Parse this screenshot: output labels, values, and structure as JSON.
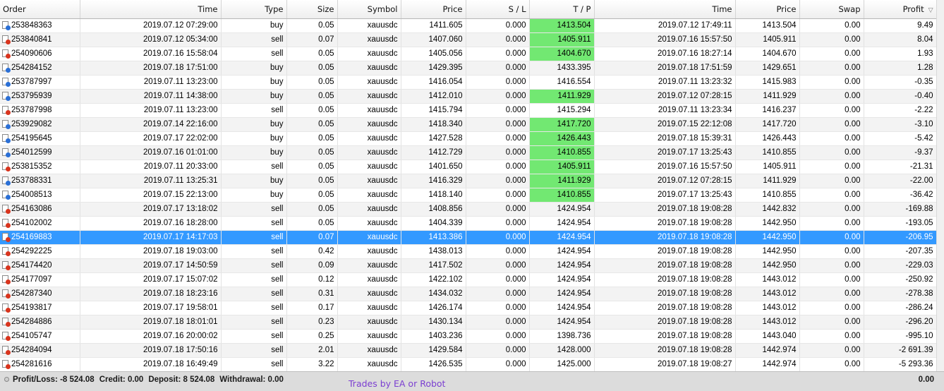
{
  "columns": [
    {
      "key": "order",
      "label": "Order"
    },
    {
      "key": "time",
      "label": "Time"
    },
    {
      "key": "type",
      "label": "Type"
    },
    {
      "key": "size",
      "label": "Size"
    },
    {
      "key": "symbol",
      "label": "Symbol"
    },
    {
      "key": "price",
      "label": "Price"
    },
    {
      "key": "sl",
      "label": "S / L"
    },
    {
      "key": "tp",
      "label": "T / P"
    },
    {
      "key": "close_time",
      "label": "Time"
    },
    {
      "key": "close_price",
      "label": "Price"
    },
    {
      "key": "swap",
      "label": "Swap"
    },
    {
      "key": "profit",
      "label": "Profit"
    }
  ],
  "sort_column": "profit",
  "sort_icon": "sort-desc-triangle-icon",
  "colors": {
    "tp_hit": "#72e872",
    "selected_row": "#3399ff",
    "buy_icon": "#2a6fd6",
    "sell_icon": "#d9341d",
    "watermark": "#7b3fd1"
  },
  "rows": [
    {
      "order": "253848363",
      "time": "2019.07.12 07:29:00",
      "type": "buy",
      "size": "0.05",
      "symbol": "xauusdc",
      "price": "1411.605",
      "sl": "0.000",
      "tp": "1413.504",
      "tp_hit": true,
      "close_time": "2019.07.12 17:49:11",
      "close_price": "1413.504",
      "swap": "0.00",
      "profit": "9.49"
    },
    {
      "order": "253840841",
      "time": "2019.07.12 05:34:00",
      "type": "sell",
      "size": "0.07",
      "symbol": "xauusdc",
      "price": "1407.060",
      "sl": "0.000",
      "tp": "1405.911",
      "tp_hit": true,
      "close_time": "2019.07.16 15:57:50",
      "close_price": "1405.911",
      "swap": "0.00",
      "profit": "8.04"
    },
    {
      "order": "254090606",
      "time": "2019.07.16 15:58:04",
      "type": "sell",
      "size": "0.05",
      "symbol": "xauusdc",
      "price": "1405.056",
      "sl": "0.000",
      "tp": "1404.670",
      "tp_hit": true,
      "close_time": "2019.07.16 18:27:14",
      "close_price": "1404.670",
      "swap": "0.00",
      "profit": "1.93"
    },
    {
      "order": "254284152",
      "time": "2019.07.18 17:51:00",
      "type": "buy",
      "size": "0.05",
      "symbol": "xauusdc",
      "price": "1429.395",
      "sl": "0.000",
      "tp": "1433.395",
      "tp_hit": false,
      "close_time": "2019.07.18 17:51:59",
      "close_price": "1429.651",
      "swap": "0.00",
      "profit": "1.28"
    },
    {
      "order": "253787997",
      "time": "2019.07.11 13:23:00",
      "type": "buy",
      "size": "0.05",
      "symbol": "xauusdc",
      "price": "1416.054",
      "sl": "0.000",
      "tp": "1416.554",
      "tp_hit": false,
      "close_time": "2019.07.11 13:23:32",
      "close_price": "1415.983",
      "swap": "0.00",
      "profit": "-0.35"
    },
    {
      "order": "253795939",
      "time": "2019.07.11 14:38:00",
      "type": "buy",
      "size": "0.05",
      "symbol": "xauusdc",
      "price": "1412.010",
      "sl": "0.000",
      "tp": "1411.929",
      "tp_hit": true,
      "close_time": "2019.07.12 07:28:15",
      "close_price": "1411.929",
      "swap": "0.00",
      "profit": "-0.40"
    },
    {
      "order": "253787998",
      "time": "2019.07.11 13:23:00",
      "type": "sell",
      "size": "0.05",
      "symbol": "xauusdc",
      "price": "1415.794",
      "sl": "0.000",
      "tp": "1415.294",
      "tp_hit": false,
      "close_time": "2019.07.11 13:23:34",
      "close_price": "1416.237",
      "swap": "0.00",
      "profit": "-2.22"
    },
    {
      "order": "253929082",
      "time": "2019.07.14 22:16:00",
      "type": "buy",
      "size": "0.05",
      "symbol": "xauusdc",
      "price": "1418.340",
      "sl": "0.000",
      "tp": "1417.720",
      "tp_hit": true,
      "close_time": "2019.07.15 22:12:08",
      "close_price": "1417.720",
      "swap": "0.00",
      "profit": "-3.10"
    },
    {
      "order": "254195645",
      "time": "2019.07.17 22:02:00",
      "type": "buy",
      "size": "0.05",
      "symbol": "xauusdc",
      "price": "1427.528",
      "sl": "0.000",
      "tp": "1426.443",
      "tp_hit": true,
      "close_time": "2019.07.18 15:39:31",
      "close_price": "1426.443",
      "swap": "0.00",
      "profit": "-5.42"
    },
    {
      "order": "254012599",
      "time": "2019.07.16 01:01:00",
      "type": "buy",
      "size": "0.05",
      "symbol": "xauusdc",
      "price": "1412.729",
      "sl": "0.000",
      "tp": "1410.855",
      "tp_hit": true,
      "close_time": "2019.07.17 13:25:43",
      "close_price": "1410.855",
      "swap": "0.00",
      "profit": "-9.37"
    },
    {
      "order": "253815352",
      "time": "2019.07.11 20:33:00",
      "type": "sell",
      "size": "0.05",
      "symbol": "xauusdc",
      "price": "1401.650",
      "sl": "0.000",
      "tp": "1405.911",
      "tp_hit": true,
      "close_time": "2019.07.16 15:57:50",
      "close_price": "1405.911",
      "swap": "0.00",
      "profit": "-21.31"
    },
    {
      "order": "253788331",
      "time": "2019.07.11 13:25:31",
      "type": "buy",
      "size": "0.05",
      "symbol": "xauusdc",
      "price": "1416.329",
      "sl": "0.000",
      "tp": "1411.929",
      "tp_hit": true,
      "close_time": "2019.07.12 07:28:15",
      "close_price": "1411.929",
      "swap": "0.00",
      "profit": "-22.00"
    },
    {
      "order": "254008513",
      "time": "2019.07.15 22:13:00",
      "type": "buy",
      "size": "0.05",
      "symbol": "xauusdc",
      "price": "1418.140",
      "sl": "0.000",
      "tp": "1410.855",
      "tp_hit": true,
      "close_time": "2019.07.17 13:25:43",
      "close_price": "1410.855",
      "swap": "0.00",
      "profit": "-36.42"
    },
    {
      "order": "254163086",
      "time": "2019.07.17 13:18:02",
      "type": "sell",
      "size": "0.05",
      "symbol": "xauusdc",
      "price": "1408.856",
      "sl": "0.000",
      "tp": "1424.954",
      "tp_hit": false,
      "close_time": "2019.07.18 19:08:28",
      "close_price": "1442.832",
      "swap": "0.00",
      "profit": "-169.88"
    },
    {
      "order": "254102002",
      "time": "2019.07.16 18:28:00",
      "type": "sell",
      "size": "0.05",
      "symbol": "xauusdc",
      "price": "1404.339",
      "sl": "0.000",
      "tp": "1424.954",
      "tp_hit": false,
      "close_time": "2019.07.18 19:08:28",
      "close_price": "1442.950",
      "swap": "0.00",
      "profit": "-193.05"
    },
    {
      "order": "254169883",
      "time": "2019.07.17 14:17:03",
      "type": "sell",
      "size": "0.07",
      "symbol": "xauusdc",
      "price": "1413.386",
      "sl": "0.000",
      "tp": "1424.954",
      "tp_hit": false,
      "close_time": "2019.07.18 19:08:28",
      "close_price": "1442.950",
      "swap": "0.00",
      "profit": "-206.95",
      "selected": true
    },
    {
      "order": "254292225",
      "time": "2019.07.18 19:03:00",
      "type": "sell",
      "size": "0.42",
      "symbol": "xauusdc",
      "price": "1438.013",
      "sl": "0.000",
      "tp": "1424.954",
      "tp_hit": false,
      "close_time": "2019.07.18 19:08:28",
      "close_price": "1442.950",
      "swap": "0.00",
      "profit": "-207.35"
    },
    {
      "order": "254174420",
      "time": "2019.07.17 14:50:59",
      "type": "sell",
      "size": "0.09",
      "symbol": "xauusdc",
      "price": "1417.502",
      "sl": "0.000",
      "tp": "1424.954",
      "tp_hit": false,
      "close_time": "2019.07.18 19:08:28",
      "close_price": "1442.950",
      "swap": "0.00",
      "profit": "-229.03"
    },
    {
      "order": "254177097",
      "time": "2019.07.17 15:07:02",
      "type": "sell",
      "size": "0.12",
      "symbol": "xauusdc",
      "price": "1422.102",
      "sl": "0.000",
      "tp": "1424.954",
      "tp_hit": false,
      "close_time": "2019.07.18 19:08:28",
      "close_price": "1443.012",
      "swap": "0.00",
      "profit": "-250.92"
    },
    {
      "order": "254287340",
      "time": "2019.07.18 18:23:16",
      "type": "sell",
      "size": "0.31",
      "symbol": "xauusdc",
      "price": "1434.032",
      "sl": "0.000",
      "tp": "1424.954",
      "tp_hit": false,
      "close_time": "2019.07.18 19:08:28",
      "close_price": "1443.012",
      "swap": "0.00",
      "profit": "-278.38"
    },
    {
      "order": "254193817",
      "time": "2019.07.17 19:58:01",
      "type": "sell",
      "size": "0.17",
      "symbol": "xauusdc",
      "price": "1426.174",
      "sl": "0.000",
      "tp": "1424.954",
      "tp_hit": false,
      "close_time": "2019.07.18 19:08:28",
      "close_price": "1443.012",
      "swap": "0.00",
      "profit": "-286.24"
    },
    {
      "order": "254284886",
      "time": "2019.07.18 18:01:01",
      "type": "sell",
      "size": "0.23",
      "symbol": "xauusdc",
      "price": "1430.134",
      "sl": "0.000",
      "tp": "1424.954",
      "tp_hit": false,
      "close_time": "2019.07.18 19:08:28",
      "close_price": "1443.012",
      "swap": "0.00",
      "profit": "-296.20"
    },
    {
      "order": "254105747",
      "time": "2019.07.16 20:00:02",
      "type": "sell",
      "size": "0.25",
      "symbol": "xauusdc",
      "price": "1403.236",
      "sl": "0.000",
      "tp": "1398.736",
      "tp_hit": false,
      "close_time": "2019.07.18 19:08:28",
      "close_price": "1443.040",
      "swap": "0.00",
      "profit": "-995.10"
    },
    {
      "order": "254284094",
      "time": "2019.07.18 17:50:16",
      "type": "sell",
      "size": "2.01",
      "symbol": "xauusdc",
      "price": "1429.584",
      "sl": "0.000",
      "tp": "1428.000",
      "tp_hit": false,
      "close_time": "2019.07.18 19:08:28",
      "close_price": "1442.974",
      "swap": "0.00",
      "profit": "-2 691.39"
    },
    {
      "order": "254281616",
      "time": "2019.07.18 16:49:49",
      "type": "sell",
      "size": "3.22",
      "symbol": "xauusdc",
      "price": "1426.535",
      "sl": "0.000",
      "tp": "1425.000",
      "tp_hit": false,
      "close_time": "2019.07.18 19:08:27",
      "close_price": "1442.974",
      "swap": "0.00",
      "profit": "-5 293.36"
    }
  ],
  "summary": {
    "profit_loss": "Profit/Loss: -8 524.08",
    "credit": "Credit: 0.00",
    "deposit": "Deposit: 8 524.08",
    "withdrawal": "Withdrawal: 0.00",
    "total": "0.00"
  },
  "watermark": "Trades by EA or Robot"
}
